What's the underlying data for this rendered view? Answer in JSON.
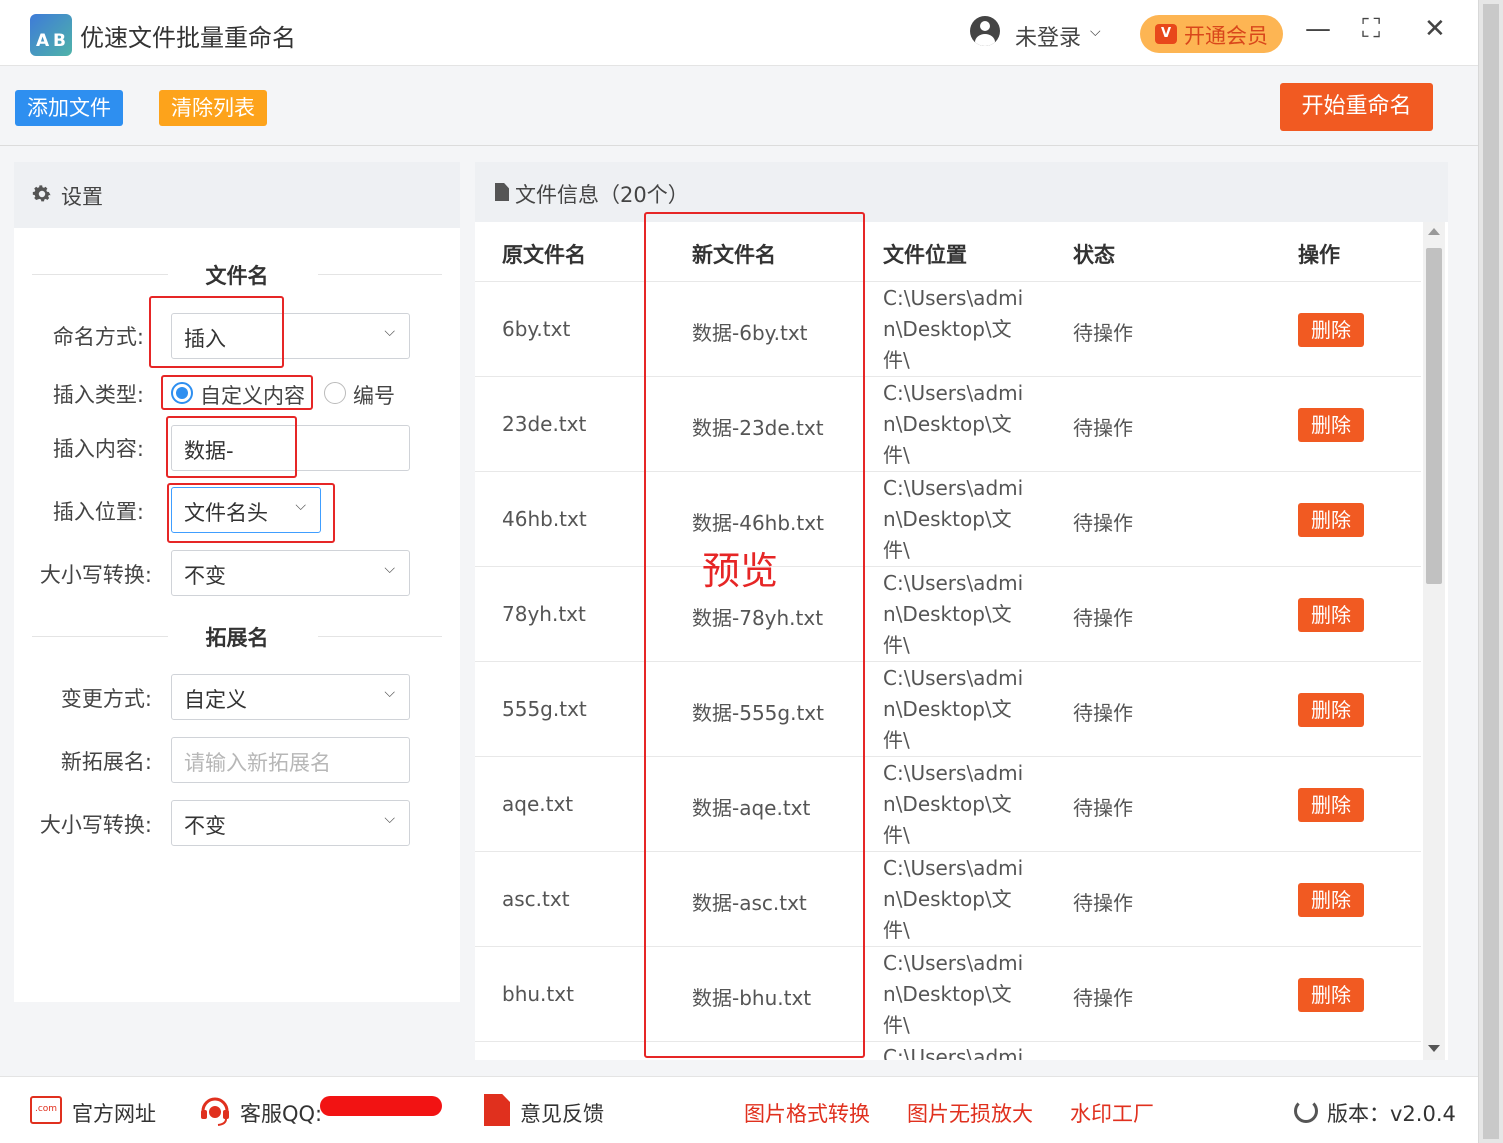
{
  "app": {
    "title": "优速文件批量重命名",
    "logo_left": "A",
    "logo_right": "B",
    "login": "未登录",
    "vip": "开通会员",
    "vip_icon": "V",
    "minimize": "—",
    "maximize": "⛶",
    "close": "✕"
  },
  "toolbar": {
    "add_label": "添加文件",
    "clear_label": "清除列表",
    "start_label": "开始重命名"
  },
  "settings": {
    "title": "设置",
    "filename_section": "文件名",
    "naming_mode_label": "命名方式:",
    "naming_mode_value": "插入",
    "insert_type_label": "插入类型:",
    "insert_type_custom": "自定义内容",
    "insert_type_number": "编号",
    "insert_content_label": "插入内容:",
    "insert_content_value": "数据-",
    "insert_position_label": "插入位置:",
    "insert_position_value": "文件名头",
    "case_label": "大小写转换:",
    "case_value": "不变",
    "ext_section": "拓展名",
    "ext_mode_label": "变更方式:",
    "ext_mode_value": "自定义",
    "new_ext_label": "新拓展名:",
    "new_ext_placeholder": "请输入新拓展名",
    "ext_case_label": "大小写转换:",
    "ext_case_value": "不变"
  },
  "files": {
    "title": "文件信息（20个）",
    "columns": [
      "原文件名",
      "新文件名",
      "文件位置",
      "状态",
      "操作"
    ],
    "preview_annotation": "预览",
    "rows": [
      {
        "orig": "6by.txt",
        "new": "数据-6by.txt",
        "loc1": "C:\\Users\\admi",
        "loc2": "n\\Desktop\\文",
        "loc3": "件\\",
        "status": "待操作",
        "action": "删除"
      },
      {
        "orig": "23de.txt",
        "new": "数据-23de.txt",
        "loc1": "C:\\Users\\admi",
        "loc2": "n\\Desktop\\文",
        "loc3": "件\\",
        "status": "待操作",
        "action": "删除"
      },
      {
        "orig": "46hb.txt",
        "new": "数据-46hb.txt",
        "loc1": "C:\\Users\\admi",
        "loc2": "n\\Desktop\\文",
        "loc3": "件\\",
        "status": "待操作",
        "action": "删除"
      },
      {
        "orig": "78yh.txt",
        "new": "数据-78yh.txt",
        "loc1": "C:\\Users\\admi",
        "loc2": "n\\Desktop\\文",
        "loc3": "件\\",
        "status": "待操作",
        "action": "删除"
      },
      {
        "orig": "555g.txt",
        "new": "数据-555g.txt",
        "loc1": "C:\\Users\\admi",
        "loc2": "n\\Desktop\\文",
        "loc3": "件\\",
        "status": "待操作",
        "action": "删除"
      },
      {
        "orig": "aqe.txt",
        "new": "数据-aqe.txt",
        "loc1": "C:\\Users\\admi",
        "loc2": "n\\Desktop\\文",
        "loc3": "件\\",
        "status": "待操作",
        "action": "删除"
      },
      {
        "orig": "asc.txt",
        "new": "数据-asc.txt",
        "loc1": "C:\\Users\\admi",
        "loc2": "n\\Desktop\\文",
        "loc3": "件\\",
        "status": "待操作",
        "action": "删除"
      },
      {
        "orig": "bhu.txt",
        "new": "数据-bhu.txt",
        "loc1": "C:\\Users\\admi",
        "loc2": "n\\Desktop\\文",
        "loc3": "件\\",
        "status": "待操作",
        "action": "删除"
      }
    ],
    "partial_loc": "C:\\Users\\admi"
  },
  "footer": {
    "website": "官方网址",
    "website_icon": ".com",
    "support": "客服QQ:",
    "feedback": "意见反馈",
    "convert": "图片格式转换",
    "enlarge": "图片无损放大",
    "watermark": "水印工厂",
    "version": "版本：v2.0.4"
  },
  "colors": {
    "primary_blue": "#2e8ff0",
    "clear_orange": "#fda31b",
    "start_red": "#f15a22",
    "annotation_red": "#e62626"
  }
}
